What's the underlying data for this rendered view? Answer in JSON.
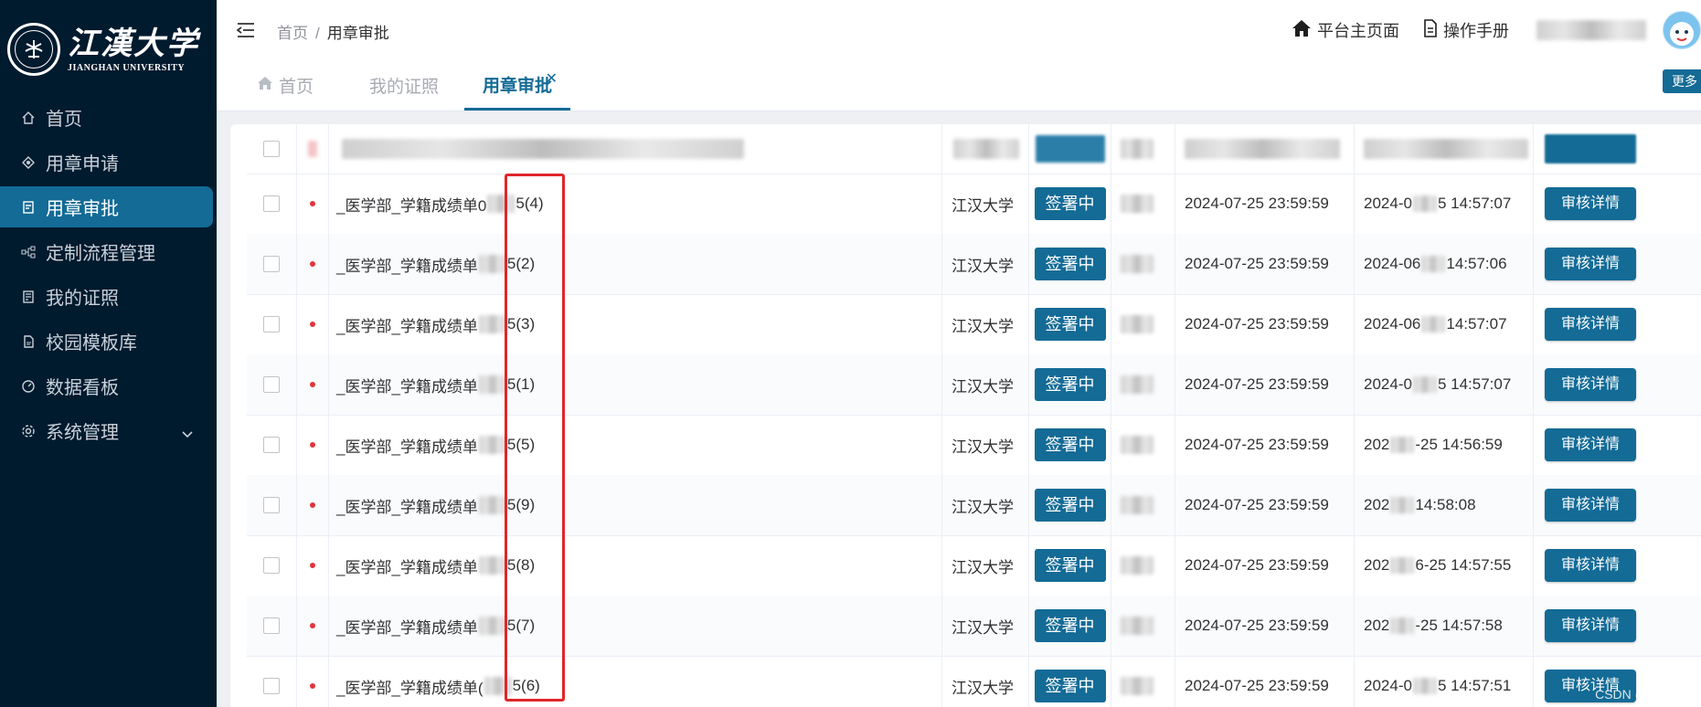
{
  "brand": {
    "name_cn": "江漢大学",
    "name_en": "JIANGHAN UNIVERSITY"
  },
  "sidebar": {
    "items": [
      {
        "label": "首页",
        "icon": "home-icon",
        "active": false
      },
      {
        "label": "用章申请",
        "icon": "stamp-icon",
        "active": false
      },
      {
        "label": "用章审批",
        "icon": "approval-icon",
        "active": true
      },
      {
        "label": "定制流程管理",
        "icon": "flow-icon",
        "active": false
      },
      {
        "label": "我的证照",
        "icon": "certificate-icon",
        "active": false
      },
      {
        "label": "校园模板库",
        "icon": "template-icon",
        "active": false
      },
      {
        "label": "数据看板",
        "icon": "dashboard-icon",
        "active": false
      },
      {
        "label": "系统管理",
        "icon": "settings-icon",
        "active": false,
        "expandable": true
      }
    ]
  },
  "header": {
    "breadcrumb": [
      "首页",
      "用章审批"
    ],
    "platform_home": "平台主页面",
    "manual": "操作手册"
  },
  "tabs": [
    {
      "label": "首页",
      "icon": "home-icon"
    },
    {
      "label": "我的证照"
    },
    {
      "label": "用章审批",
      "active": true,
      "closable": true
    }
  ],
  "more_label": "更多",
  "colors": {
    "primary": "#136b96",
    "sidebar_bg": "#001a2e",
    "dot": "#e0353b",
    "highlight": "#e0262b"
  },
  "table": {
    "rows": [
      {
        "name": "_医学部_学籍成绩单0",
        "suffix": "5(4)",
        "org": "江汉大学",
        "status": "签署中",
        "deadline": "2024-07-25 23:59:59",
        "created_prefix": "2024-0",
        "created_suffix": "5 14:57:07",
        "action": "审核详情"
      },
      {
        "name": "_医学部_学籍成绩单",
        "suffix": "5(2)",
        "org": "江汉大学",
        "status": "签署中",
        "deadline": "2024-07-25 23:59:59",
        "created_prefix": "2024-06",
        "created_suffix": " 14:57:06",
        "action": "审核详情"
      },
      {
        "name": "_医学部_学籍成绩单",
        "suffix": "5(3)",
        "org": "江汉大学",
        "status": "签署中",
        "deadline": "2024-07-25 23:59:59",
        "created_prefix": "2024-06",
        "created_suffix": " 14:57:07",
        "action": "审核详情"
      },
      {
        "name": "_医学部_学籍成绩单",
        "suffix": "5(1)",
        "org": "江汉大学",
        "status": "签署中",
        "deadline": "2024-07-25 23:59:59",
        "created_prefix": "2024-0",
        "created_suffix": "5 14:57:07",
        "action": "审核详情"
      },
      {
        "name": "_医学部_学籍成绩单",
        "suffix": "5(5)",
        "org": "江汉大学",
        "status": "签署中",
        "deadline": "2024-07-25 23:59:59",
        "created_prefix": "202",
        "created_suffix": "-25 14:56:59",
        "action": "审核详情"
      },
      {
        "name": "_医学部_学籍成绩单",
        "suffix": "5(9)",
        "org": "江汉大学",
        "status": "签署中",
        "deadline": "2024-07-25 23:59:59",
        "created_prefix": "202",
        "created_suffix": "14:58:08",
        "action": "审核详情"
      },
      {
        "name": "_医学部_学籍成绩单",
        "suffix": "5(8)",
        "org": "江汉大学",
        "status": "签署中",
        "deadline": "2024-07-25 23:59:59",
        "created_prefix": "202",
        "created_suffix": "6-25 14:57:55",
        "action": "审核详情"
      },
      {
        "name": "_医学部_学籍成绩单",
        "suffix": "5(7)",
        "org": "江汉大学",
        "status": "签署中",
        "deadline": "2024-07-25 23:59:59",
        "created_prefix": "202",
        "created_suffix": "-25 14:57:58",
        "action": "审核详情"
      },
      {
        "name": "_医学部_学籍成绩单(",
        "suffix": "5(6)",
        "org": "江汉大学",
        "status": "签署中",
        "deadline": "2024-07-25 23:59:59",
        "created_prefix": "2024-0",
        "created_suffix": "5 14:57:51",
        "action": "审核详情"
      }
    ]
  },
  "watermark": "CSDN @aichehui"
}
